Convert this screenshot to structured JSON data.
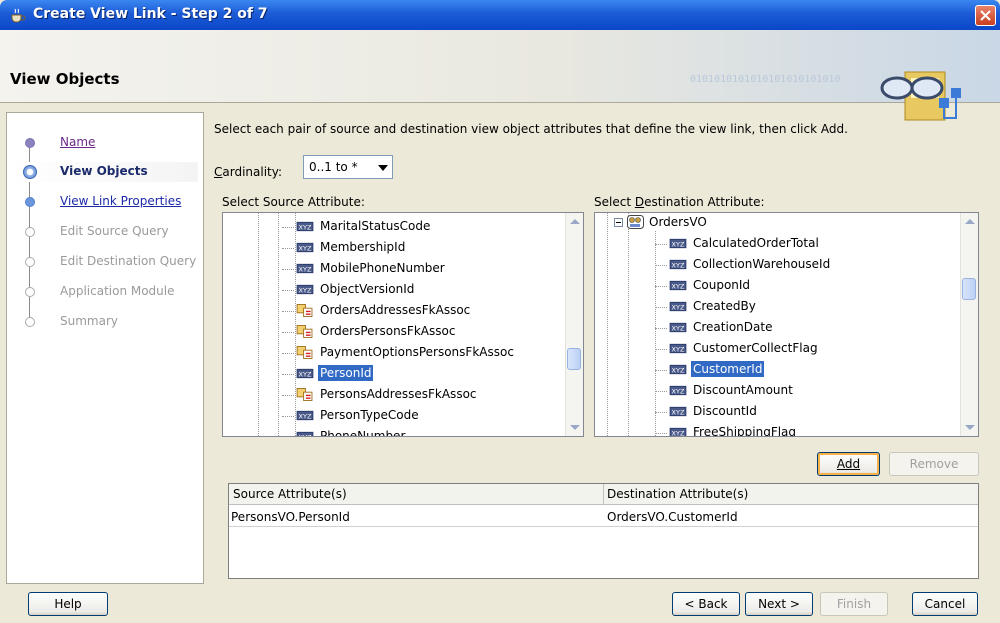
{
  "window": {
    "title": "Create View Link - Step 2 of 7"
  },
  "header": {
    "title": "View Objects",
    "binary": "0101010101010101010101010"
  },
  "steps": [
    {
      "label": "Name",
      "state": "visited"
    },
    {
      "label": "View Objects",
      "state": "current"
    },
    {
      "label": "View Link Properties",
      "state": "link"
    },
    {
      "label": "Edit Source Query",
      "state": "disabled"
    },
    {
      "label": "Edit Destination Query",
      "state": "disabled"
    },
    {
      "label": "Application Module",
      "state": "disabled"
    },
    {
      "label": "Summary",
      "state": "disabled"
    }
  ],
  "instructions": "Select each pair of source and destination view object attributes that define the view link, then click Add.",
  "cardinality": {
    "label_prefix": "C",
    "label_rest": "ardinality:",
    "value": "0..1 to *"
  },
  "source": {
    "label_pre": "Select Source Attribute:",
    "items": [
      {
        "label": "MaritalStatusCode",
        "icon": "attribute-icon"
      },
      {
        "label": "MembershipId",
        "icon": "attribute-icon"
      },
      {
        "label": "MobilePhoneNumber",
        "icon": "attribute-icon"
      },
      {
        "label": "ObjectVersionId",
        "icon": "attribute-icon"
      },
      {
        "label": "OrdersAddressesFkAssoc",
        "icon": "association-icon"
      },
      {
        "label": "OrdersPersonsFkAssoc",
        "icon": "association-icon"
      },
      {
        "label": "PaymentOptionsPersonsFkAssoc",
        "icon": "association-icon"
      },
      {
        "label": "PersonId",
        "icon": "attribute-icon",
        "selected": true
      },
      {
        "label": "PersonsAddressesFkAssoc",
        "icon": "association-icon"
      },
      {
        "label": "PersonTypeCode",
        "icon": "attribute-icon"
      },
      {
        "label": "PhoneNumber",
        "icon": "attribute-icon"
      }
    ]
  },
  "destination": {
    "label_pre": "Select ",
    "label_u": "D",
    "label_post": "estination Attribute:",
    "root": "OrdersVO",
    "items": [
      {
        "label": "CalculatedOrderTotal",
        "icon": "attribute-icon"
      },
      {
        "label": "CollectionWarehouseId",
        "icon": "attribute-icon"
      },
      {
        "label": "CouponId",
        "icon": "attribute-icon"
      },
      {
        "label": "CreatedBy",
        "icon": "attribute-icon"
      },
      {
        "label": "CreationDate",
        "icon": "attribute-icon"
      },
      {
        "label": "CustomerCollectFlag",
        "icon": "attribute-icon"
      },
      {
        "label": "CustomerId",
        "icon": "attribute-icon",
        "selected": true
      },
      {
        "label": "DiscountAmount",
        "icon": "attribute-icon"
      },
      {
        "label": "DiscountId",
        "icon": "attribute-icon"
      },
      {
        "label": "FreeShippingFlag",
        "icon": "attribute-icon"
      }
    ]
  },
  "buttons": {
    "add": "Add",
    "remove": "Remove",
    "help": "Help",
    "back": "< Back",
    "next": "Next >",
    "finish": "Finish",
    "cancel": "Cancel"
  },
  "table": {
    "columns": [
      "Source Attribute(s)",
      "Destination Attribute(s)"
    ],
    "rows": [
      [
        "PersonsVO.PersonId",
        "OrdersVO.CustomerId"
      ]
    ]
  },
  "colors": {
    "titlebar": "#0a47c9",
    "selection": "#316ac5",
    "default_button_glow": "#f9b248"
  }
}
